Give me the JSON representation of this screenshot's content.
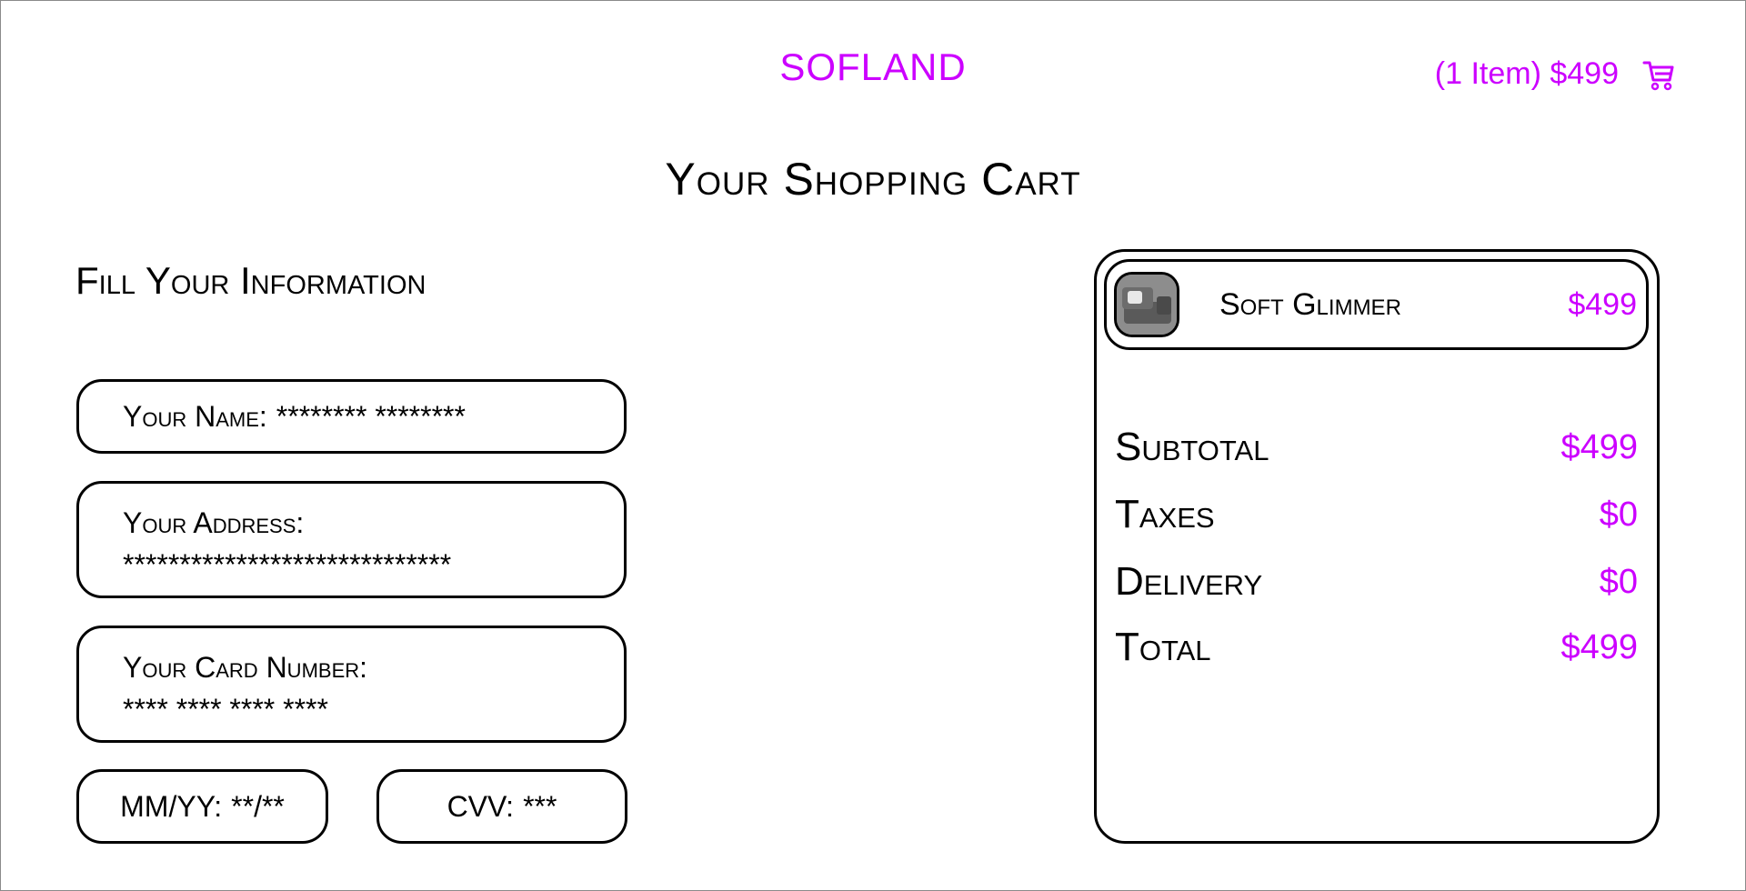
{
  "header": {
    "brand": "SOFLAND",
    "cart_summary": "(1 Item) $499",
    "cart_icon": "shopping-cart-icon",
    "accent_color": "#cc00ff"
  },
  "page": {
    "title": "Your Shopping Cart"
  },
  "form": {
    "section_title": "Fill Your Information",
    "name": {
      "label": "Your Name:",
      "value": "******** ********"
    },
    "address": {
      "label": "Your Address:",
      "value": "*****************************"
    },
    "card": {
      "label": "Your Card Number:",
      "value": "**** **** **** ****"
    },
    "expiry": {
      "label": "MM/YY:",
      "value": "**/**"
    },
    "cvv": {
      "label": "CVV:",
      "value": "***"
    }
  },
  "order": {
    "items": [
      {
        "name": "Soft Glimmer",
        "price": "$499",
        "thumbnail_icon": "sofa-thumbnail"
      }
    ],
    "summary": {
      "subtotal": {
        "label": "Subtotal",
        "value": "$499"
      },
      "taxes": {
        "label": "Taxes",
        "value": "$0"
      },
      "delivery": {
        "label": "Delivery",
        "value": "$0"
      },
      "total": {
        "label": "Total",
        "value": "$499"
      }
    }
  }
}
